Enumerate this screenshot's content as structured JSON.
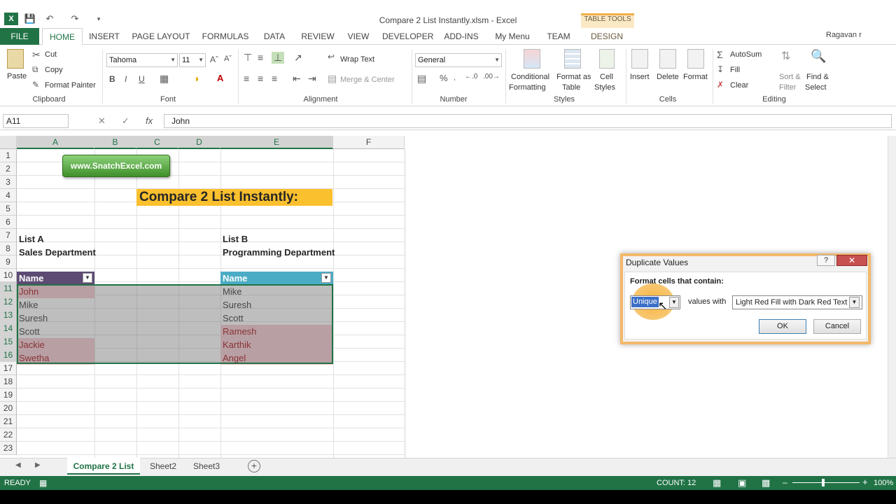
{
  "app": {
    "doc_title": "Compare 2 List Instantly.xlsm - Excel",
    "user": "Ragavan r",
    "table_tools_label": "TABLE TOOLS"
  },
  "tabs": [
    {
      "label": "FILE"
    },
    {
      "label": "HOME"
    },
    {
      "label": "INSERT"
    },
    {
      "label": "PAGE LAYOUT"
    },
    {
      "label": "FORMULAS"
    },
    {
      "label": "DATA"
    },
    {
      "label": "REVIEW"
    },
    {
      "label": "VIEW"
    },
    {
      "label": "DEVELOPER"
    },
    {
      "label": "ADD-INS"
    },
    {
      "label": "My Menu"
    },
    {
      "label": "TEAM"
    },
    {
      "label": "DESIGN"
    }
  ],
  "ribbon": {
    "clipboard": {
      "paste": "Paste",
      "cut": "Cut",
      "copy": "Copy",
      "format_painter": "Format Painter",
      "group": "Clipboard"
    },
    "font": {
      "name": "Tahoma",
      "size": "11",
      "group": "Font"
    },
    "alignment": {
      "wrap": "Wrap Text",
      "merge": "Merge & Center",
      "group": "Alignment"
    },
    "number": {
      "format": "General",
      "group": "Number"
    },
    "styles": {
      "cond1": "Conditional",
      "cond2": "Formatting",
      "fmt1": "Format as",
      "fmt2": "Table",
      "cell1": "Cell",
      "cell2": "Styles",
      "group": "Styles"
    },
    "cells": {
      "insert": "Insert",
      "delete": "Delete",
      "format": "Format",
      "group": "Cells"
    },
    "editing": {
      "autosum": "AutoSum",
      "fill": "Fill",
      "clear": "Clear",
      "sort1": "Sort &",
      "sort2": "Filter",
      "find1": "Find &",
      "find2": "Select",
      "group": "Editing"
    }
  },
  "formula_bar": {
    "name_box": "A11",
    "value": "John"
  },
  "columns": [
    "A",
    "B",
    "C",
    "D",
    "E",
    "F"
  ],
  "rows": [
    "1",
    "2",
    "3",
    "4",
    "5",
    "6",
    "7",
    "8",
    "9",
    "10",
    "11",
    "12",
    "13",
    "14",
    "15",
    "16",
    "17",
    "18",
    "19",
    "20",
    "21",
    "22",
    "23"
  ],
  "sheet": {
    "web_button": "www.SnatchExcel.com",
    "title": "Compare 2 List Instantly:",
    "list_a_title": "List A",
    "list_a_sub": "Sales Department",
    "list_b_title": "List B",
    "list_b_sub": "Programming Department",
    "header_a": "Name",
    "header_b": "Name",
    "list_a": [
      {
        "name": "John",
        "highlight": true
      },
      {
        "name": "Mike",
        "highlight": false
      },
      {
        "name": "Suresh",
        "highlight": false
      },
      {
        "name": "Scott",
        "highlight": false
      },
      {
        "name": "Jackie",
        "highlight": true
      },
      {
        "name": "Swetha",
        "highlight": true
      }
    ],
    "list_b": [
      {
        "name": "Mike",
        "highlight": false
      },
      {
        "name": "Suresh",
        "highlight": false
      },
      {
        "name": "Scott",
        "highlight": false
      },
      {
        "name": "Ramesh",
        "highlight": true
      },
      {
        "name": "Karthik",
        "highlight": true
      },
      {
        "name": "Angel",
        "highlight": true
      }
    ]
  },
  "sheet_tabs": [
    "Compare 2 List",
    "Sheet2",
    "Sheet3"
  ],
  "status": {
    "mode": "READY",
    "count": "COUNT: 12",
    "zoom": "100%"
  },
  "dialog": {
    "title": "Duplicate Values",
    "help": "?",
    "close": "✕",
    "label": "Format cells that contain:",
    "type_value": "Unique",
    "mid_text": "values with",
    "format_value": "Light Red Fill with Dark Red Text",
    "ok": "OK",
    "cancel": "Cancel"
  },
  "colors": {
    "excel_green": "#217346",
    "table_header_a": "#5d4b73",
    "table_header_b": "#4bacc6",
    "highlight_fill": "#f4c7ce",
    "highlight_text": "#9c0006",
    "title_fill": "#fbc02d"
  }
}
